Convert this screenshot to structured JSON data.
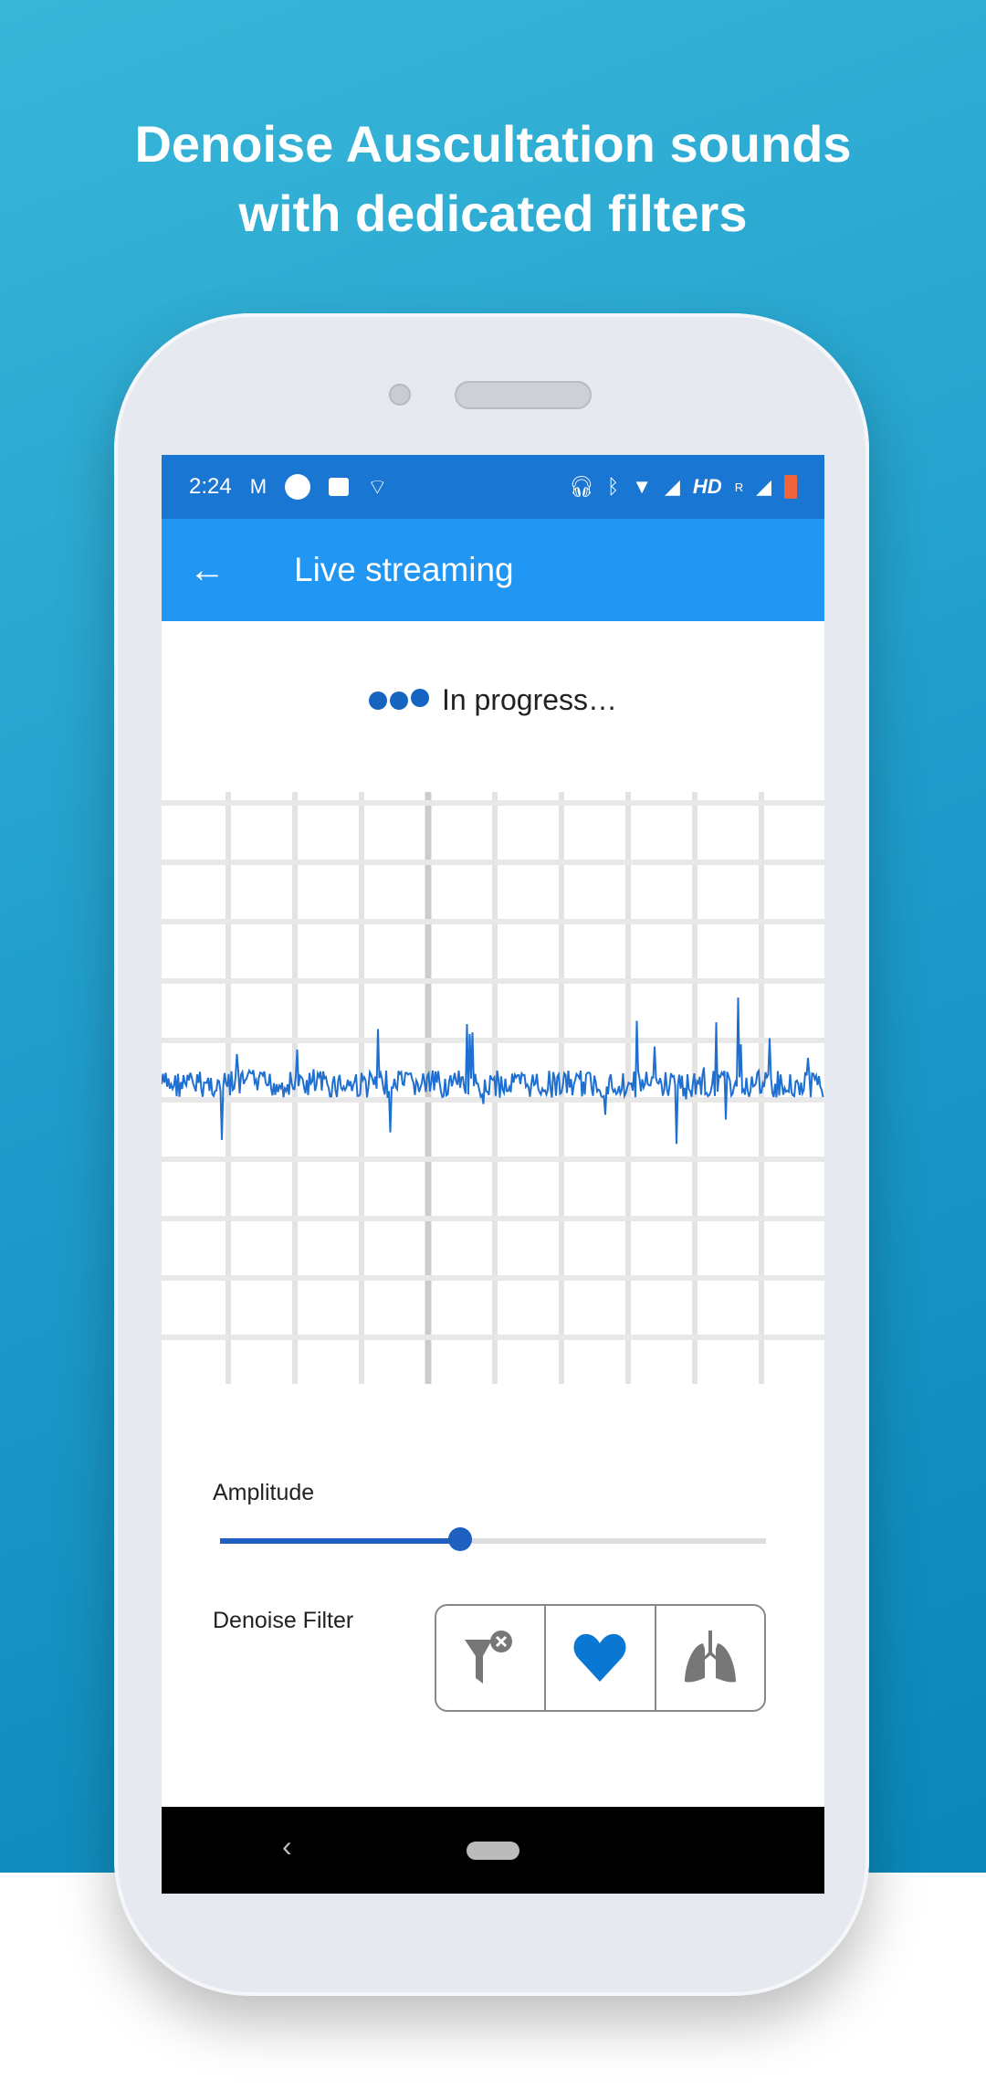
{
  "headline": {
    "line1": "Denoise Auscultation sounds",
    "line2": "with dedicated filters"
  },
  "status_bar": {
    "time": "2:24",
    "icons": [
      "gmail-icon",
      "circle-icon",
      "news-icon",
      "cast-icon",
      "headset-icon",
      "bluetooth-icon",
      "wifi-icon",
      "signal-x-icon",
      "signal-icon",
      "battery-icon"
    ],
    "hd": "HD",
    "roaming": "R",
    "battery_color": "#f0643c"
  },
  "app_bar": {
    "title": "Live streaming",
    "back_icon": "arrow-left-icon"
  },
  "progress": {
    "text": "In progress…"
  },
  "amplitude": {
    "label": "Amplitude",
    "value_percent": 44
  },
  "denoise": {
    "label": "Denoise Filter",
    "options": [
      "no-filter",
      "heart",
      "lungs"
    ],
    "selected": "heart"
  },
  "colors": {
    "status_bar": "#1976d2",
    "app_bar": "#2196f3",
    "accent": "#1e5fc0",
    "waveform": "#1f6fd0",
    "selected_icon": "#0a78d2"
  }
}
